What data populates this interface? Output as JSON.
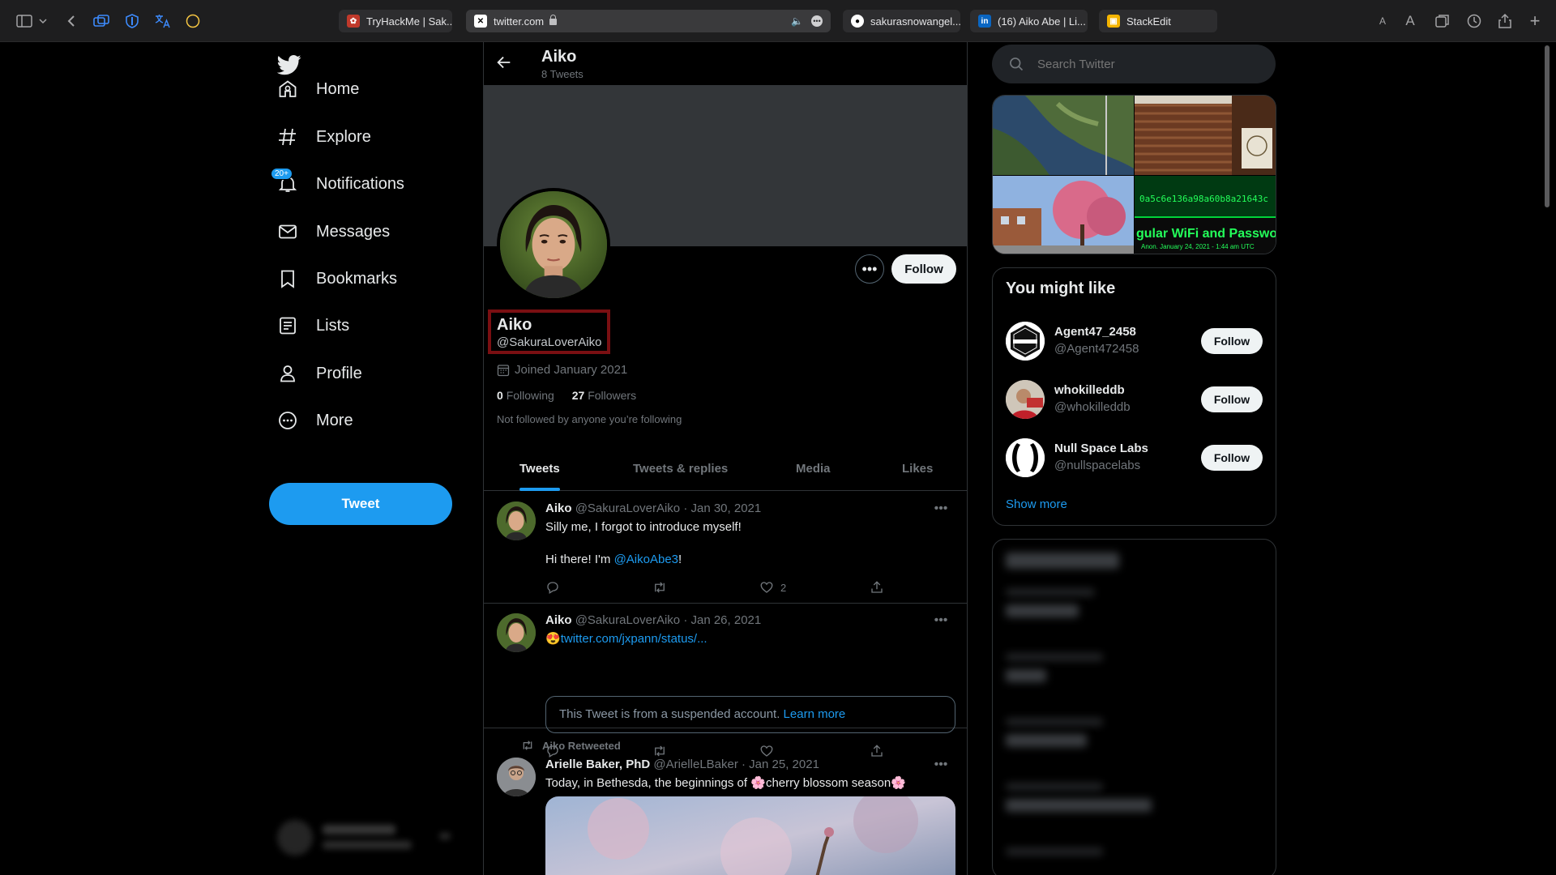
{
  "browser": {
    "tabs": [
      {
        "title": "TryHackMe | Sak..."
      },
      {
        "title": "twitter.com"
      },
      {
        "title": "sakurasnowangel..."
      },
      {
        "title": "(16) Aiko Abe | Li..."
      },
      {
        "title": "StackEdit"
      }
    ],
    "toolbar_right": {
      "small_a": "A",
      "large_a": "A"
    }
  },
  "nav": {
    "items": [
      {
        "label": "Home"
      },
      {
        "label": "Explore"
      },
      {
        "label": "Notifications",
        "badge": "20+"
      },
      {
        "label": "Messages"
      },
      {
        "label": "Bookmarks"
      },
      {
        "label": "Lists"
      },
      {
        "label": "Profile"
      },
      {
        "label": "More"
      }
    ],
    "tweet_button": "Tweet"
  },
  "profile": {
    "top_name": "Aiko",
    "tweet_count": "8 Tweets",
    "name": "Aiko",
    "handle": "@SakuraLoverAiko",
    "joined": "Joined January 2021",
    "following_count": "0",
    "following_label": "Following",
    "followers_count": "27",
    "followers_label": "Followers",
    "not_followed": "Not followed by anyone you’re following",
    "follow_button": "Follow",
    "more_button": "•••"
  },
  "profile_tabs": [
    {
      "label": "Tweets",
      "active": true
    },
    {
      "label": "Tweets & replies"
    },
    {
      "label": "Media"
    },
    {
      "label": "Likes"
    }
  ],
  "tweets": [
    {
      "name": "Aiko",
      "handle": "@SakuraLoverAiko",
      "date": "· Jan 30, 2021",
      "line1": "Silly me, I forgot to introduce myself!",
      "line2_prefix": "Hi there! I'm ",
      "line2_link": "@AikoAbe3",
      "line2_suffix": "!",
      "likes": "2"
    },
    {
      "name": "Aiko",
      "handle": "@SakuraLoverAiko",
      "date": "· Jan 26, 2021",
      "emoji": "😍",
      "link": "twitter.com/jxpann/status/...",
      "quote_text": "This Tweet is from a suspended account.",
      "quote_link": "Learn more"
    },
    {
      "retweeted_by": "Aiko Retweeted",
      "name": "Arielle Baker, PhD",
      "handle": "@ArielleLBaker",
      "date": "· Jan 25, 2021",
      "text_prefix": "Today, in Bethesda, the beginnings of ",
      "flower1": "🌸",
      "text_mid": "cherry blossom season",
      "flower2": "🌸"
    }
  ],
  "sidebar": {
    "search_placeholder": "Search Twitter",
    "photo_hash": "0a5c6e136a98a60b8a21643c",
    "photo_caption": "gular WiFi and Passwor",
    "photo_subcaption": "Anon. January 24, 2021 - 1:44 am UTC",
    "might_like_title": "You might like",
    "suggestions": [
      {
        "name": "Agent47_2458",
        "handle": "@Agent472458",
        "button": "Follow"
      },
      {
        "name": "whokilleddb",
        "handle": "@whokilleddb",
        "button": "Follow"
      },
      {
        "name": "Null Space Labs",
        "handle": "@nullspacelabs",
        "button": "Follow"
      }
    ],
    "show_more": "Show more"
  },
  "colors": {
    "accent": "#1d9bf0",
    "background": "#000000",
    "highlight_box": "#7a0f12"
  }
}
